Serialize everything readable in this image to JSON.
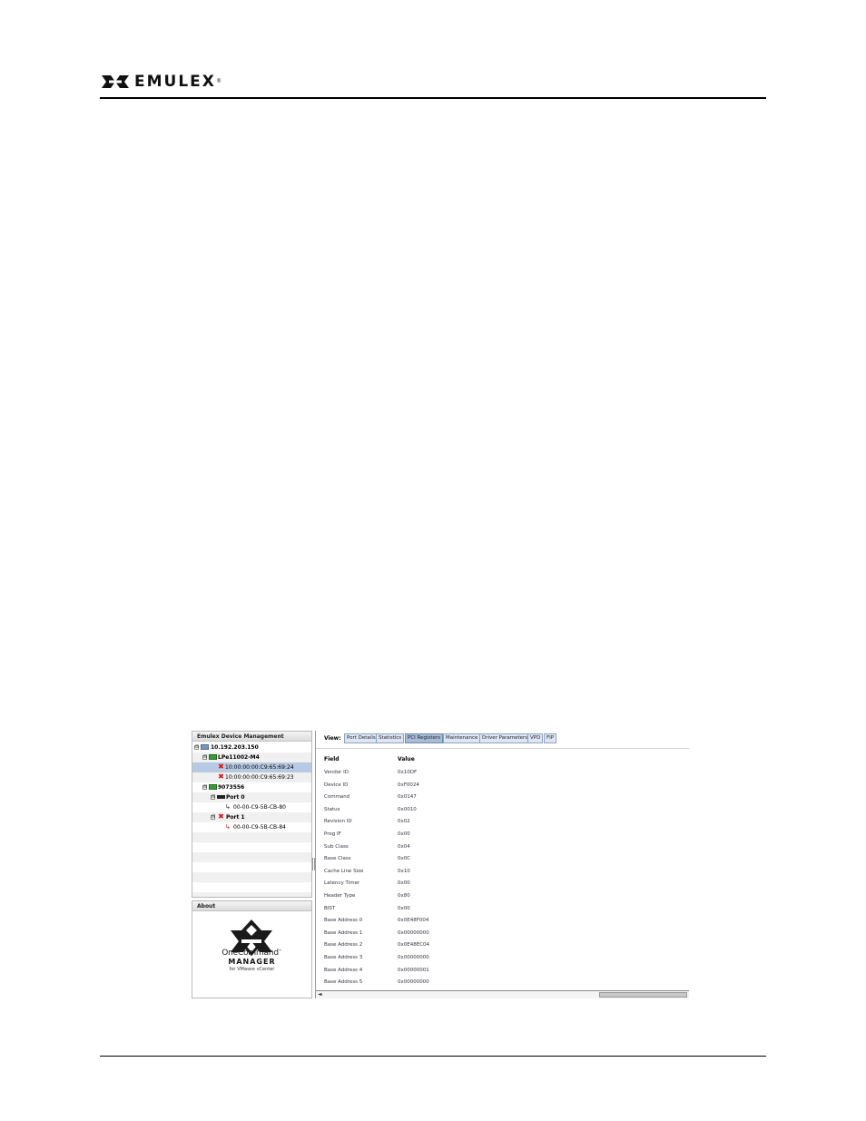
{
  "brand": {
    "name": "EMULEX",
    "trademark": "®"
  },
  "screenshot": {
    "tree_panel": {
      "title": "Emulex Device Management",
      "nodes": [
        {
          "label": "10.192.203.150",
          "icon": "host-icon",
          "expander": "⊟"
        },
        {
          "label": "LPe11002-M4",
          "icon": "adapter-icon",
          "expander": "⊟"
        },
        {
          "label": "10:00:00:00:C9:65:69:24",
          "icon": "port-offline-icon"
        },
        {
          "label": "10:00:00:00:C9:65:69:23",
          "icon": "port-offline-icon"
        },
        {
          "label": "9073556",
          "icon": "adapter-icon",
          "expander": "⊟"
        },
        {
          "label": "Port 0",
          "icon": "port-icon",
          "expander": "⊟"
        },
        {
          "label": "00-00-C9-5B-CB-80",
          "icon": "network-cable-icon"
        },
        {
          "label": "Port 1",
          "icon": "port-offline-icon",
          "expander": "⊟"
        },
        {
          "label": "00-00-C9-5B-CB-84",
          "icon": "network-cable-offline-icon"
        }
      ]
    },
    "about_panel": {
      "title": "About",
      "product_name": "OneCommand",
      "product_tm": "™",
      "product_sub": "MANAGER",
      "product_for": "for VMware vCenter"
    },
    "view_bar": {
      "label": "View:",
      "tabs": [
        "Port Details",
        "Statistics",
        "PCI Registers",
        "Maintenance",
        "Driver Parameters",
        "VPD",
        "FIP"
      ],
      "active_tab": "PCI Registers"
    },
    "pci_table": {
      "headers": {
        "field": "Field",
        "value": "Value"
      },
      "rows": [
        {
          "field": "Vendor ID",
          "value": "0x10DF"
        },
        {
          "field": "Device ID",
          "value": "0xF0024"
        },
        {
          "field": "Command",
          "value": "0x0147"
        },
        {
          "field": "Status",
          "value": "0x0010"
        },
        {
          "field": "Revision ID",
          "value": "0x02"
        },
        {
          "field": "Prog IF",
          "value": "0x00"
        },
        {
          "field": "Sub Class",
          "value": "0x04"
        },
        {
          "field": "Base Class",
          "value": "0x0C"
        },
        {
          "field": "Cache Line Size",
          "value": "0x10"
        },
        {
          "field": "Latency Timer",
          "value": "0x00"
        },
        {
          "field": "Header Type",
          "value": "0x80"
        },
        {
          "field": "BIST",
          "value": "0x00"
        },
        {
          "field": "Base Address 0",
          "value": "0x0E48F004"
        },
        {
          "field": "Base Address 1",
          "value": "0x00000000"
        },
        {
          "field": "Base Address 2",
          "value": "0x0E48EC04"
        },
        {
          "field": "Base Address 3",
          "value": "0x00000000"
        },
        {
          "field": "Base Address 4",
          "value": "0x00000001"
        },
        {
          "field": "Base Address 5",
          "value": "0x00000000"
        }
      ]
    },
    "scrollbar": {
      "left_arrow": "◄"
    }
  }
}
